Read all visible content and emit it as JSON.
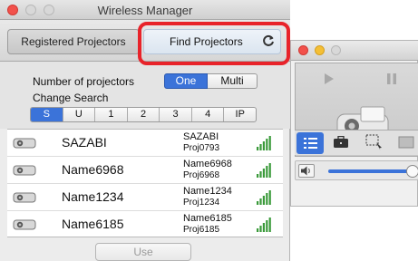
{
  "window": {
    "title": "Wireless Manager"
  },
  "tabs": {
    "registered": "Registered Projectors",
    "find": "Find Projectors"
  },
  "settings": {
    "number_label": "Number of projectors",
    "options": [
      "One",
      "Multi"
    ],
    "selected_option": "One",
    "change_search_label": "Change Search",
    "search_tabs": [
      "S",
      "U",
      "1",
      "2",
      "3",
      "4",
      "IP"
    ],
    "selected_search_tab": "S"
  },
  "projectors": [
    {
      "name": "SAZABI",
      "line1": "SAZABI",
      "line2": "Proj0793",
      "icon": "projector-icon"
    },
    {
      "name": "Name6968",
      "line1": "Name6968",
      "line2": "Proj6968",
      "icon": "projector-icon"
    },
    {
      "name": "Name1234",
      "line1": "Name1234",
      "line2": "Proj1234",
      "icon": "projector-icon"
    },
    {
      "name": "Name6185",
      "line1": "Name6185",
      "line2": "Proj6185",
      "icon": "projector-icon"
    }
  ],
  "use_button": "Use",
  "colors": {
    "accent": "#3b73d9",
    "highlight": "#e8232a",
    "signal": "#3a9a3a"
  }
}
